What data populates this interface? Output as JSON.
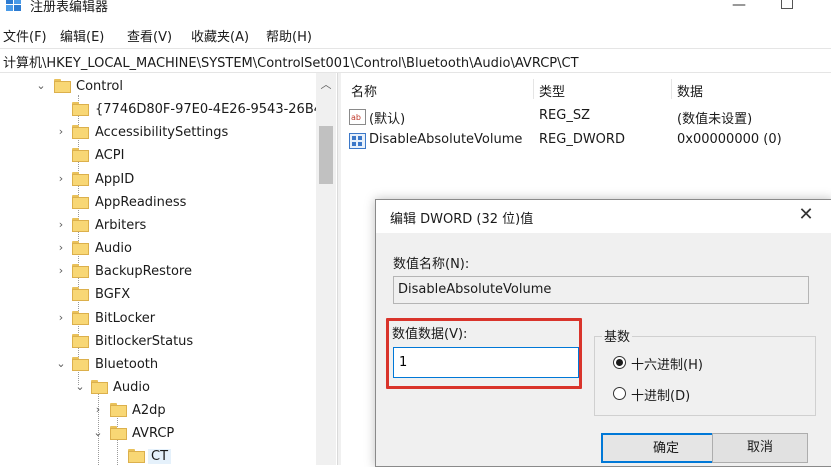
{
  "window": {
    "title": "注册表编辑器"
  },
  "menu": [
    "文件(F)",
    "编辑(E)",
    "查看(V)",
    "收藏夹(A)",
    "帮助(H)"
  ],
  "address": "计算机\\HKEY_LOCAL_MACHINE\\SYSTEM\\ControlSet001\\Control\\Bluetooth\\Audio\\AVRCP\\CT",
  "tree": [
    {
      "label": "Control",
      "expanded": true
    },
    {
      "label": "{7746D80F-97E0-4E26-9543-26B4",
      "expanded": false
    },
    {
      "label": "AccessibilitySettings",
      "expanded": false
    },
    {
      "label": "ACPI",
      "expanded": false
    },
    {
      "label": "AppID",
      "expanded": false
    },
    {
      "label": "AppReadiness",
      "expanded": false
    },
    {
      "label": "Arbiters",
      "expanded": false
    },
    {
      "label": "Audio",
      "expanded": false
    },
    {
      "label": "BackupRestore",
      "expanded": false
    },
    {
      "label": "BGFX",
      "expanded": false
    },
    {
      "label": "BitLocker",
      "expanded": false
    },
    {
      "label": "BitlockerStatus",
      "expanded": false
    },
    {
      "label": "Bluetooth",
      "expanded": true
    },
    {
      "label": "Audio",
      "expanded": true
    },
    {
      "label": "A2dp",
      "expanded": false
    },
    {
      "label": "AVRCP",
      "expanded": true
    },
    {
      "label": "CT",
      "selected": true
    }
  ],
  "list": {
    "headers": {
      "name": "名称",
      "type": "类型",
      "data": "数据"
    },
    "rows": [
      {
        "icon": "string-value-icon",
        "name": "(默认)",
        "type": "REG_SZ",
        "data": "(数值未设置)"
      },
      {
        "icon": "binary-value-icon",
        "name": "DisableAbsoluteVolume",
        "type": "REG_DWORD",
        "data": "0x00000000 (0)"
      }
    ]
  },
  "dialog": {
    "title": "编辑 DWORD (32 位)值",
    "name_label": "数值名称(N):",
    "name_value": "DisableAbsoluteVolume",
    "data_label": "数值数据(V):",
    "data_value": "1",
    "base_label": "基数",
    "radio_hex": "十六进制(H)",
    "radio_dec": "十进制(D)",
    "selected_base": "hex",
    "ok": "确定",
    "cancel": "取消"
  },
  "colors": {
    "highlight_box": "#d9342b",
    "accent": "#0078d7",
    "folder": "#f8d775"
  }
}
